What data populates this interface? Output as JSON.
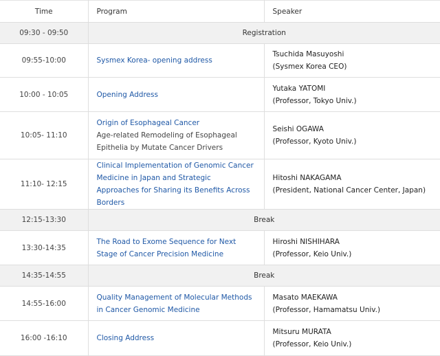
{
  "headers": {
    "time": "Time",
    "program": "Program",
    "speaker": "Speaker"
  },
  "rows": [
    {
      "time": "09:30 - 09:50",
      "span": "Registration"
    },
    {
      "time": "09:55-10:00",
      "title": "Sysmex Korea- opening address",
      "subtitle": "",
      "speaker_name": "Tsuchida Masuyoshi",
      "speaker_affil": "(Sysmex Korea CEO)"
    },
    {
      "time": "10:00 - 10:05",
      "title": "Opening Address",
      "subtitle": "",
      "speaker_name": "Yutaka YATOMI",
      "speaker_affil": "(Professor, Tokyo Univ.)"
    },
    {
      "time": "10:05- 11:10",
      "title": "Origin of Esophageal Cancer",
      "subtitle": "Age-related Remodeling of Esophageal Epithelia by Mutate Cancer Drivers",
      "speaker_name": "Seishi OGAWA",
      "speaker_affil": "(Professor, Kyoto Univ.)"
    },
    {
      "time": "11:10- 12:15",
      "title": "Clinical Implementation of Genomic Cancer Medicine in Japan and Strategic Approaches for Sharing its Benefits Across Borders",
      "subtitle": "",
      "speaker_name": "Hitoshi NAKAGAMA",
      "speaker_affil": "(President, National Cancer Center, Japan)"
    },
    {
      "time": "12:15-13:30",
      "span": "Break"
    },
    {
      "time": "13:30-14:35",
      "title": "The Road to Exome Sequence for Next Stage of Cancer Precision Medicine",
      "subtitle": "",
      "speaker_name": "Hiroshi NISHIHARA",
      "speaker_affil": "(Professor, Keio Univ.)"
    },
    {
      "time": "14:35-14:55",
      "span": "Break"
    },
    {
      "time": "14:55-16:00",
      "title": "Quality Management of Molecular Methods in Cancer Genomic Medicine",
      "subtitle": "",
      "speaker_name": "Masato MAEKAWA",
      "speaker_affil": "(Professor, Hamamatsu Univ.)"
    },
    {
      "time": "16:00 -16:10",
      "title": "Closing Address",
      "subtitle": "",
      "speaker_name": "Mitsuru MURATA",
      "speaker_affil": "(Professor, Keio Univ.)"
    }
  ]
}
